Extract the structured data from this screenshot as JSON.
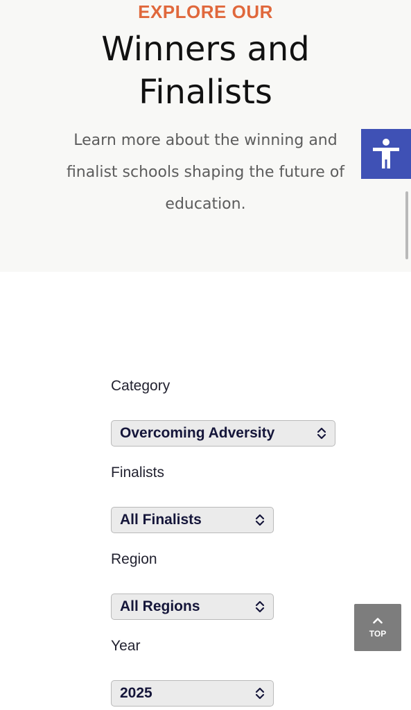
{
  "hero": {
    "eyebrow": "EXPLORE OUR",
    "title_line1": "Winners and",
    "title_line2": "Finalists",
    "intro_line1": "Learn more about the winning and",
    "intro_line2": "finalist schools shaping the future of",
    "intro_line3": "education."
  },
  "accessibility": {
    "icon": "accessibility-person-icon",
    "color": "#3f51b5"
  },
  "filters": {
    "category": {
      "label": "Category",
      "value": "Overcoming Adversity"
    },
    "finalists": {
      "label": "Finalists",
      "value": "All Finalists"
    },
    "region": {
      "label": "Region",
      "value": "All Regions"
    },
    "year": {
      "label": "Year",
      "value": "2025"
    }
  },
  "back_to_top": {
    "label": "TOP",
    "icon": "chevron-up-icon"
  },
  "colors": {
    "accent": "#e0683c",
    "select_text": "#15163a",
    "hero_bg": "#f8f8f6"
  }
}
